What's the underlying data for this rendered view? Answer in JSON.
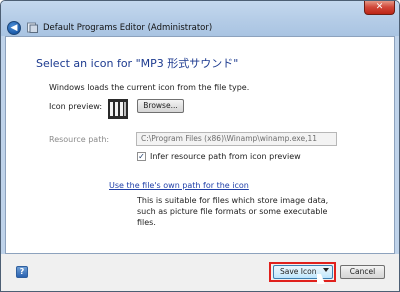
{
  "window": {
    "title": "Default Programs Editor (Administrator)",
    "close_glyph": "✕",
    "back_glyph": "◀"
  },
  "main": {
    "heading": "Select an icon for \"MP3 形式サウンド\"",
    "description": "Windows loads the current icon from the file type.",
    "icon_preview_label": "Icon preview:",
    "preview_icon_name": "mp3-file-icon",
    "browse_label": "Browse...",
    "resource_path_label": "Resource path:",
    "resource_path_value": "C:\\Program Files (x86)\\Winamp\\winamp.exe,11",
    "infer_checkbox_label": "Infer resource path from icon preview",
    "infer_checked": true,
    "use_own_path_link": "Use the file's own path for the icon",
    "use_own_path_help": "This is suitable for files which store image data, such as picture file formats or some executable files."
  },
  "footer": {
    "help_glyph": "?",
    "save_label": "Save Icon",
    "cancel_label": "Cancel"
  },
  "colors": {
    "heading": "#1c3a8f",
    "link": "#1f3fa8",
    "highlight": "#e0201c"
  }
}
